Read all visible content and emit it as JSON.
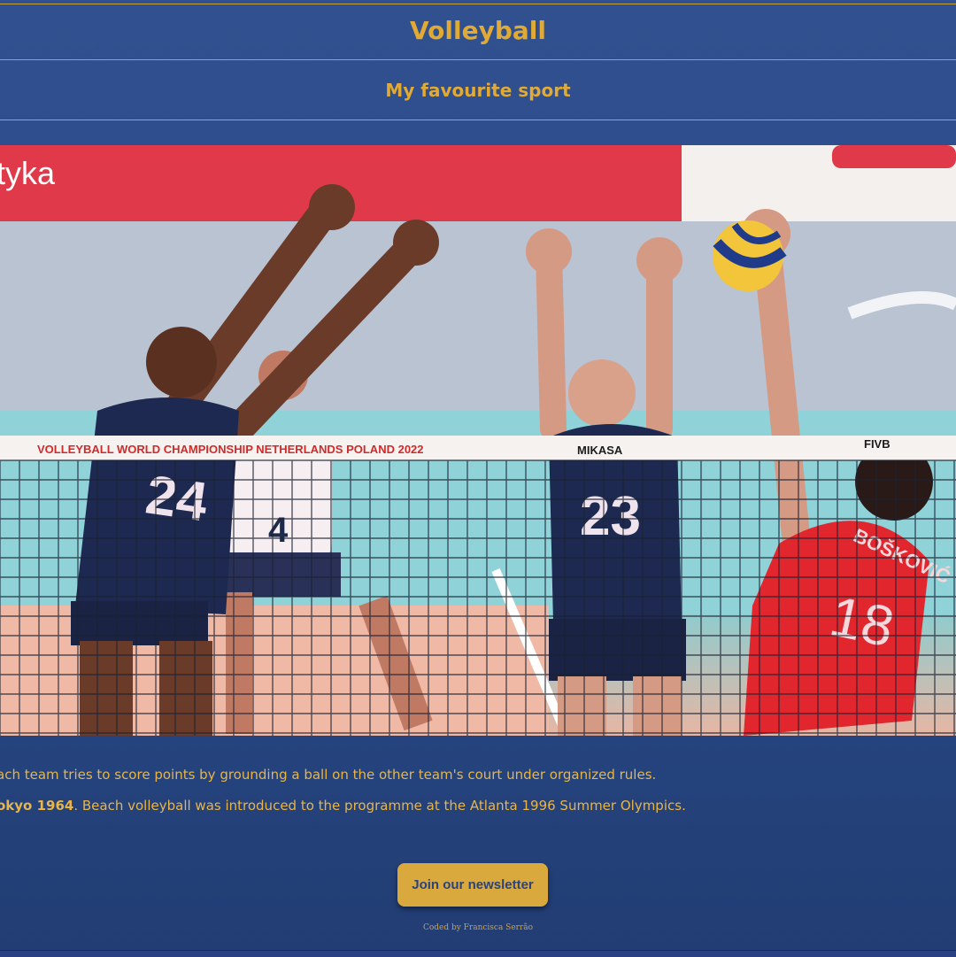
{
  "header": {
    "title": "Volleyball",
    "subtitle": "My favourite sport"
  },
  "hero_image": {
    "alt": "Volleyball players blocking a spike at the net",
    "banner_text": "tyka",
    "net_banner_text": "VOLLEYBALL WORLD CHAMPIONSHIP NETHERLANDS POLAND 2022",
    "net_sponsor": "MIKASA",
    "net_logo": "FIVB",
    "jerseys": [
      "24",
      "4",
      "23",
      "18"
    ],
    "player_name": "BOŠKOVIĆ"
  },
  "content": {
    "line1": "ach team tries to score points by grounding a ball on the other team's court under organized rules.",
    "line2_bold": "okyo 1964",
    "line2_rest": ". Beach volleyball was introduced to the programme at the Atlanta 1996 Summer Olympics."
  },
  "newsletter": {
    "button_label": "Join our newsletter"
  },
  "footer": {
    "credit": "Coded by Francisca Serrão"
  },
  "colors": {
    "background": "#2f4f8e",
    "accent": "#e0aa35",
    "button": "#d9a93d",
    "button_text": "#2a427e"
  }
}
